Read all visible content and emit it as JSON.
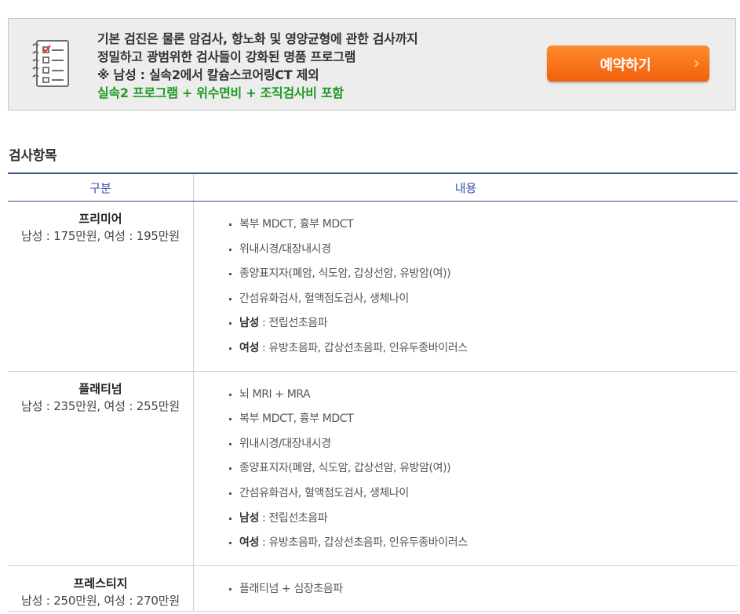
{
  "banner": {
    "lines": [
      "기본 검진은 물론 암검사, 항노화 및 영양균형에 관한 검사까지",
      "정밀하고 광범위한 검사들이 강화된 명품 프로그램",
      "※ 남성 : 실속2에서 칼슘스코어링CT 제외"
    ],
    "highlight": "실속2 프로그램 + 위수면비 + 조직검사비 포함",
    "button_label": "예약하기",
    "button_chevron": "›",
    "icon": "checklist-icon",
    "colors": {
      "accent": "#f47a1e",
      "highlight": "#1e9a24",
      "header": "#3a52a8"
    }
  },
  "section_title": "검사항목",
  "table": {
    "headers": [
      "구분",
      "내용"
    ],
    "rows": [
      {
        "name": "프리미어",
        "price": "남성 : 175만원, 여성 : 195만원",
        "items": [
          {
            "text": "복부 MDCT, 흉부 MDCT"
          },
          {
            "text": "위내시경/대장내시경"
          },
          {
            "text": "종양표지자(폐암, 식도암, 갑상선암, 유방암(여))"
          },
          {
            "text": "간섬유화검사, 혈액점도검사, 생체나이"
          },
          {
            "label": "남성",
            "text": " : 전립선초음파"
          },
          {
            "label": "여성",
            "text": " : 유방초음파, 갑상선초음파, 인유두종바이러스"
          }
        ]
      },
      {
        "name": "플래티넘",
        "price": "남성 : 235만원, 여성 : 255만원",
        "items": [
          {
            "text": "뇌 MRI + MRA"
          },
          {
            "text": "복부 MDCT, 흉부 MDCT"
          },
          {
            "text": "위내시경/대장내시경"
          },
          {
            "text": "종양표지자(폐암, 식도암, 갑상선암, 유방암(여))"
          },
          {
            "text": "간섬유화검사, 혈액점도검사, 생체나이"
          },
          {
            "label": "남성",
            "text": " : 전립선초음파"
          },
          {
            "label": "여성",
            "text": " : 유방초음파, 갑상선초음파, 인유두종바이러스"
          }
        ]
      },
      {
        "name": "프레스티지",
        "price": "남성 : 250만원, 여성 : 270만원",
        "items": [
          {
            "text": "플래티넘 + 심장초음파"
          }
        ]
      }
    ]
  }
}
